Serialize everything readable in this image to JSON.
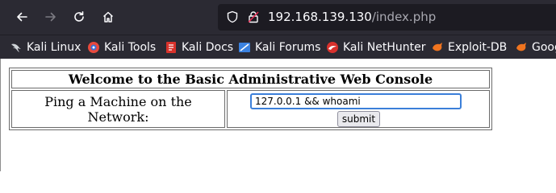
{
  "browser": {
    "url_host": "192.168.139.130",
    "url_path": "/index.php"
  },
  "bookmarks": [
    {
      "label": "Kali Linux",
      "icon": "kali-dragon-icon"
    },
    {
      "label": "Kali Tools",
      "icon": "kali-tools-icon"
    },
    {
      "label": "Kali Docs",
      "icon": "kali-docs-icon"
    },
    {
      "label": "Kali Forums",
      "icon": "kali-forums-icon"
    },
    {
      "label": "Kali NetHunter",
      "icon": "kali-nethunter-icon"
    },
    {
      "label": "Exploit-DB",
      "icon": "exploit-db-icon"
    },
    {
      "label": "Goog",
      "icon": "google-hacking-db-icon"
    }
  ],
  "page": {
    "title": "Welcome to the Basic Administrative Web Console",
    "ping_label": "Ping a Machine on the Network:",
    "input_value": "127.0.0.1 && whoami",
    "submit_label": "submit"
  }
}
